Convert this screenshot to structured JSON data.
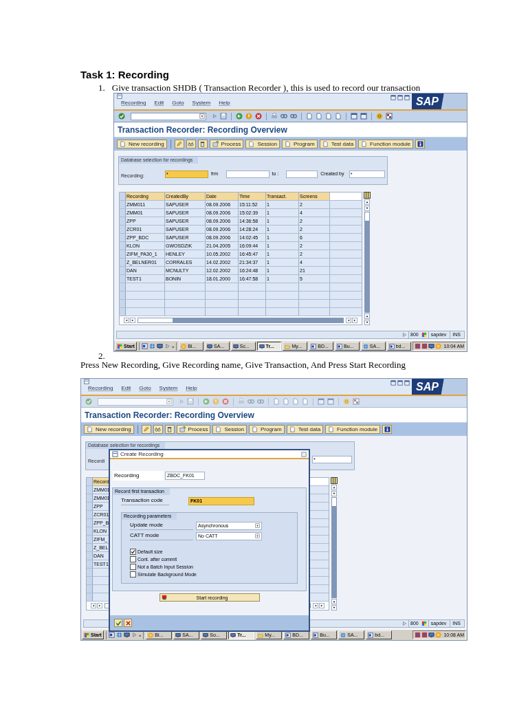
{
  "heading": "Task 1: Recording",
  "steps": [
    {
      "number": "1.",
      "text": "Give transaction SHDB ( Transaction Recorder ), this is used to record our transaction"
    },
    {
      "number": "2.",
      "text": "Press New Recording, Give Recording name, Give Transaction, And Press Start Recording"
    }
  ],
  "screenshots": [
    {
      "menu": [
        "Recording",
        "Edit",
        "Goto",
        "System",
        "Help"
      ],
      "logo": "SAP",
      "title": "Transaction Recorder: Recording Overview",
      "app_buttons": [
        "New recording",
        "Process",
        "Session",
        "Program",
        "Test data",
        "Function module"
      ],
      "selection": {
        "title": "Database selection for recordings",
        "recording_label": "Recording:",
        "recording_value": "*",
        "from_label": "frm",
        "to_label": "to :",
        "created_by_label": "Created by",
        "created_by_value": "*"
      },
      "table": {
        "columns": [
          "Recording",
          "CreatedBy",
          "Date",
          "Time",
          "Transact.",
          "Screens"
        ],
        "rows": [
          [
            "ZMM011",
            "SAPUSER",
            "08.09.2006",
            "15:11:52",
            "1",
            "2"
          ],
          [
            "ZMM01",
            "SAPUSER",
            "08.09.2006",
            "15:02:39",
            "1",
            "4"
          ],
          [
            "ZPP",
            "SAPUSER",
            "08.09.2006",
            "14:36:58",
            "1",
            "2"
          ],
          [
            "ZCR01",
            "SAPUSER",
            "08.09.2006",
            "14:28:24",
            "1",
            "2"
          ],
          [
            "ZPP_BDC",
            "SAPUSER",
            "08.09.2006",
            "14:02:45",
            "1",
            "6"
          ],
          [
            "KLON",
            "GWOSDZIK",
            "21.04.2005",
            "16:09:44",
            "1",
            "2"
          ],
          [
            "ZIFM_PA30_1",
            "HENLEY",
            "10.05.2002",
            "16:45:47",
            "1",
            "2"
          ],
          [
            "Z_BELNER01",
            "CORRALES",
            "14.02.2002",
            "21:34:37",
            "1",
            "4"
          ],
          [
            "DAN",
            "MCNULTY",
            "12.02.2002",
            "16:24:48",
            "1",
            "21"
          ],
          [
            "TEST1",
            "BONIN",
            "18.01.2000",
            "16:47:58",
            "1",
            "5"
          ]
        ]
      },
      "status": {
        "client": "800",
        "server": "sapdev",
        "mode": "INS"
      },
      "taskbar": {
        "start": "Start",
        "more": "»",
        "items": [
          {
            "label": "Bl...",
            "selected": false
          },
          {
            "label": "SA...",
            "selected": false
          },
          {
            "label": "Sc...",
            "selected": false
          },
          {
            "label": "Tr...",
            "selected": true
          },
          {
            "label": "My...",
            "selected": false
          },
          {
            "label": "BD...",
            "selected": false
          },
          {
            "label": "Bu...",
            "selected": false
          },
          {
            "label": "SA...",
            "selected": false
          },
          {
            "label": "bd...",
            "selected": false
          }
        ],
        "clock": "10:04 AM"
      }
    },
    {
      "menu": [
        "Recording",
        "Edit",
        "Goto",
        "System",
        "Help"
      ],
      "logo": "SAP",
      "title": "Transaction Recorder: Recording Overview",
      "app_buttons": [
        "New recording",
        "Process",
        "Session",
        "Program",
        "Test data",
        "Function module"
      ],
      "selection": {
        "title": "Database selection for recordings",
        "recording_label": "Recordi",
        "created_by_value": "*"
      },
      "table": {
        "columns": [
          "Record"
        ],
        "rows": [
          [
            "ZMM01"
          ],
          [
            "ZMM01"
          ],
          [
            "ZPP"
          ],
          [
            "ZCR01"
          ],
          [
            "ZPP_B"
          ],
          [
            "KLON"
          ],
          [
            "ZIFM_"
          ],
          [
            "Z_BEL"
          ],
          [
            "DAN"
          ],
          [
            "TEST1"
          ]
        ]
      },
      "dialog": {
        "title": "Create Recording",
        "recording_label": "Recording",
        "recording_value": "ZBDC_FK01",
        "group1": "Record first transaction",
        "tcode_label": "Transaction code",
        "tcode_value": "FK01",
        "group2": "Recording parameters",
        "params": [
          {
            "label": "Update mode",
            "value": "Asynchronous"
          },
          {
            "label": "CATT mode",
            "value": "No CATT"
          }
        ],
        "options": [
          {
            "label": "Default size",
            "checked": true
          },
          {
            "label": "Cont. after commit",
            "checked": false
          },
          {
            "label": "Not a Batch Input Session",
            "checked": false
          },
          {
            "label": "Simulate Background Mode",
            "checked": false
          }
        ],
        "start_button": "Start recording"
      },
      "status": {
        "client": "800",
        "server": "sapdev",
        "mode": "INS"
      },
      "taskbar": {
        "start": "Start",
        "more": "»",
        "items": [
          {
            "label": "Bl...",
            "selected": false
          },
          {
            "label": "SA...",
            "selected": false
          },
          {
            "label": "So...",
            "selected": false
          },
          {
            "label": "Tr...",
            "selected": true
          },
          {
            "label": "My...",
            "selected": false
          },
          {
            "label": "BD...",
            "selected": false
          },
          {
            "label": "Bu...",
            "selected": false
          },
          {
            "label": "SA...",
            "selected": false
          },
          {
            "label": "bd...",
            "selected": false
          }
        ],
        "clock": "10:08 AM"
      }
    }
  ]
}
